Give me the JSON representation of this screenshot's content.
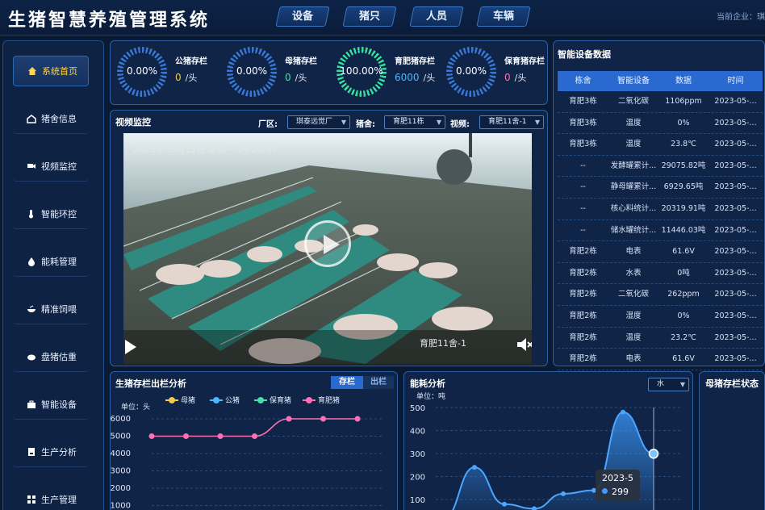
{
  "header": {
    "title": "生猪智慧养殖管理系统",
    "tabs": [
      "设备",
      "猪只",
      "人员",
      "车辆"
    ],
    "company_label": "当前企业：琪"
  },
  "sidebar": {
    "items": [
      {
        "label": "系统首页",
        "icon": "home-icon"
      },
      {
        "label": "猪舍信息",
        "icon": "barn-icon"
      },
      {
        "label": "视频监控",
        "icon": "camera-icon"
      },
      {
        "label": "智能环控",
        "icon": "thermometer-icon"
      },
      {
        "label": "能耗管理",
        "icon": "energy-drop-icon"
      },
      {
        "label": "精准饲喂",
        "icon": "feed-bowl-icon"
      },
      {
        "label": "盘猪估重",
        "icon": "scale-icon"
      },
      {
        "label": "智能设备",
        "icon": "toolbox-icon"
      },
      {
        "label": "生产分析",
        "icon": "document-icon"
      },
      {
        "label": "生产管理",
        "icon": "grid-icon"
      }
    ]
  },
  "stats": [
    {
      "percent": "0.00%",
      "label": "公猪存栏",
      "value": "0",
      "unit": "/头",
      "color": "#f2c94c"
    },
    {
      "percent": "0.00%",
      "label": "母猪存栏",
      "value": "0",
      "unit": "/头",
      "color": "#45e0a8"
    },
    {
      "percent": "100.00%",
      "label": "育肥猪存栏",
      "value": "6000",
      "unit": "/头",
      "color": "#4db8ff"
    },
    {
      "percent": "0.00%",
      "label": "保育猪存栏",
      "value": "0",
      "unit": "/头",
      "color": "#ff6fb3"
    }
  ],
  "video": {
    "title": "视频监控",
    "factory_label": "厂区:",
    "factory_value": "琪泰远觉厂",
    "barn_label": "猪舍:",
    "barn_value": "育肥11栋",
    "video_label": "视频:",
    "video_value": "育肥11舍-1",
    "timestamp": "2023年05月15日  星期一  14:20:57",
    "caption": "育肥11舍-1"
  },
  "device_table": {
    "title": "智能设备数据",
    "headers": [
      "栋舍",
      "智能设备",
      "数据",
      "时间"
    ],
    "rows": [
      [
        "育肥3栋",
        "二氧化碳",
        "1106ppm",
        "2023-05-..."
      ],
      [
        "育肥3栋",
        "温度",
        "0%",
        "2023-05-..."
      ],
      [
        "育肥3栋",
        "温度",
        "23.8℃",
        "2023-05-..."
      ],
      [
        "--",
        "发酵罐累计...",
        "29075.82吨",
        "2023-05-..."
      ],
      [
        "--",
        "静母罐累计...",
        "6929.65吨",
        "2023-05-..."
      ],
      [
        "--",
        "核心料统计...",
        "20319.91吨",
        "2023-05-..."
      ],
      [
        "--",
        "储水罐统计...",
        "11446.03吨",
        "2023-05-..."
      ],
      [
        "育肥2栋",
        "电表",
        "61.6V",
        "2023-05-..."
      ],
      [
        "育肥2栋",
        "水表",
        "0吨",
        "2023-05-..."
      ],
      [
        "育肥2栋",
        "二氧化碳",
        "262ppm",
        "2023-05-..."
      ],
      [
        "育肥2栋",
        "湿度",
        "0%",
        "2023-05-..."
      ],
      [
        "育肥2栋",
        "温度",
        "23.2℃",
        "2023-05-..."
      ],
      [
        "育肥2栋",
        "电表",
        "61.6V",
        "2023-05-..."
      ]
    ]
  },
  "stock_panel": {
    "title": "生猪存栏出栏分析",
    "tab_active": "存栏",
    "tab_inactive": "出栏",
    "unit_label": "单位：头"
  },
  "energy_panel": {
    "title": "能耗分析",
    "unit_label": "单位：吨",
    "select_value": "水",
    "tooltip_title": "2023-5",
    "tooltip_value": "299"
  },
  "status_panel": {
    "title": "母猪存栏状态"
  },
  "chart_data": [
    {
      "type": "line",
      "title": "生猪存栏出栏分析",
      "ylabel": "单位：头",
      "yticks": [
        1000,
        2000,
        3000,
        4000,
        5000,
        6000
      ],
      "legend_position": "top",
      "series": [
        {
          "name": "母猪",
          "color": "#f2c94c",
          "values": [
            0,
            0,
            0,
            0,
            0,
            0,
            0
          ]
        },
        {
          "name": "公猪",
          "color": "#4db8ff",
          "values": [
            0,
            0,
            0,
            0,
            0,
            0,
            0
          ]
        },
        {
          "name": "保育猪",
          "color": "#45e0a8",
          "values": [
            0,
            0,
            0,
            0,
            0,
            0,
            0
          ]
        },
        {
          "name": "育肥猪",
          "color": "#ff6fb3",
          "values": [
            5000,
            5000,
            5000,
            5000,
            6000,
            6000,
            6000
          ]
        }
      ]
    },
    {
      "type": "area",
      "title": "能耗分析",
      "ylabel": "单位：吨",
      "yticks": [
        100,
        200,
        300,
        400,
        500
      ],
      "series": [
        {
          "color": "#3d9bff",
          "values": [
            20,
            240,
            80,
            60,
            125,
            140,
            480,
            299
          ]
        }
      ]
    }
  ]
}
